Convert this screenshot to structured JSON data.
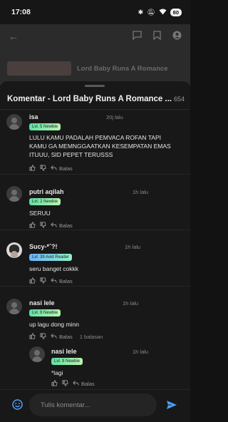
{
  "status_bar": {
    "time": "17:08",
    "battery": "80"
  },
  "background": {
    "book_title": "Lord Baby Runs A Romance"
  },
  "sheet": {
    "title": "Komentar - Lord Baby Runs A Romance ...",
    "count": "654"
  },
  "comments": [
    {
      "user": "isa",
      "badge": "Lvl. 5 Newbie",
      "time": "20j lalu",
      "text_lines": [
        "LULU KAMU PADALAH PEMVACA ROFAN TAPI",
        "KAMU GA MEMNGGAATKAN KESEMPATAN EMAS",
        "ITUUU, SID PEPET TERUSSS"
      ],
      "reply_label": "Balas"
    },
    {
      "user": "putri aqilah",
      "badge": "Lvl. 2 Newbie",
      "time": "1h lalu",
      "text_lines": [
        "SERUU"
      ],
      "reply_label": "Balas"
    },
    {
      "user": "Sucy-*ˆ?!",
      "badge": "Lvl. 39 Avid Reader",
      "time": "1h lalu",
      "text_lines": [
        "seru banget cokkk"
      ],
      "reply_label": "Balas"
    },
    {
      "user": "nasi lele",
      "badge": "Lvl. 9 Newbie",
      "time": "1h lalu",
      "text_lines": [
        "up lagu dong minn"
      ],
      "reply_label": "Balas",
      "replies_count": "1 balasan"
    },
    {
      "user": "nasi lele",
      "badge": "Lvl. 9 Newbie",
      "time": "1h lalu",
      "text_lines": [
        "*lagi"
      ],
      "reply_label": "Balas"
    }
  ],
  "input": {
    "placeholder": "Tulis komentar..."
  },
  "icons": [
    "back-arrow-icon",
    "chat-icon",
    "bookmark-icon",
    "account-icon",
    "avatar-icon",
    "thumbs-up-icon",
    "thumbs-down-icon",
    "reply-icon",
    "emoji-icon",
    "send-icon"
  ],
  "colors": {
    "accent": "#4aa3ff",
    "newbie_badge": "#7ee8b0",
    "avid_reader_badge": "#6ab4ff"
  }
}
